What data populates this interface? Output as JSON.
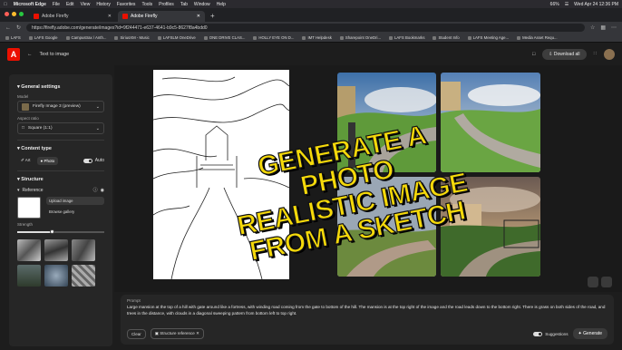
{
  "macbar": {
    "app": "Microsoft Edge",
    "menus": [
      "File",
      "Edit",
      "View",
      "History",
      "Favorites",
      "Tools",
      "Profiles",
      "Tab",
      "Window",
      "Help"
    ],
    "battery": "66%",
    "clock": "Wed Apr 24  12:36 PM"
  },
  "tabs": [
    {
      "label": "Adobe Firefly",
      "active": false
    },
    {
      "label": "Adobe Firefly",
      "active": true
    }
  ],
  "address": {
    "url": "https://firefly.adobe.com/generate/images?id=9f244471-e637-4641-b9c5-8627f8a4bdd0"
  },
  "bookmarks": [
    "LAFS",
    "LAFS Google",
    "Campustrax / Anth...",
    "SiriusXM - Music",
    "LAFSLM OneDrive",
    "ONE DRIVE CLAS...",
    "HOLLY EYE ON D...",
    "IMT Helpdesk",
    "Sharepoint OneDri...",
    "LAFS Bookmarks",
    "Student Info",
    "LAFS Meeting Age...",
    "Media Asset Requ..."
  ],
  "appbar": {
    "logo": "A",
    "title": "Text to image",
    "download": "Download all"
  },
  "sidebar": {
    "general_title": "General settings",
    "model_label": "Model",
    "model_value": "Firefly Image 3 (preview)",
    "aspect_label": "Aspect ratio",
    "aspect_value": "Square (1:1)",
    "content_title": "Content type",
    "content_art": "Art",
    "content_photo": "Photo",
    "content_auto": "Auto",
    "structure_title": "Structure",
    "reference_label": "Reference",
    "upload": "Upload image",
    "browse": "Browse gallery",
    "strength_label": "Strength",
    "strength": 0.4
  },
  "prompt": {
    "label": "Prompt",
    "text": "Large mansion at the top of a hill with gate around like a fortress, with winding road coming from the gate to bottom of the hill. The mansion is at the top right of the image and the road leads down to the bottom right. There is grass on both sides of the road, and trees in the distance, with clouds in a diagonal sweeping pattern from bottom left to top right.",
    "clear": "Clear",
    "chip": "Structure reference",
    "suggestions": "Suggestions",
    "generate": "Generate"
  },
  "overlay": [
    "GENERATE A PHOTO",
    "REALISTIC IMAGE",
    "FROM A SKETCH"
  ],
  "colors": {
    "accent": "#eb1000",
    "overlay": "#f5d90a"
  }
}
